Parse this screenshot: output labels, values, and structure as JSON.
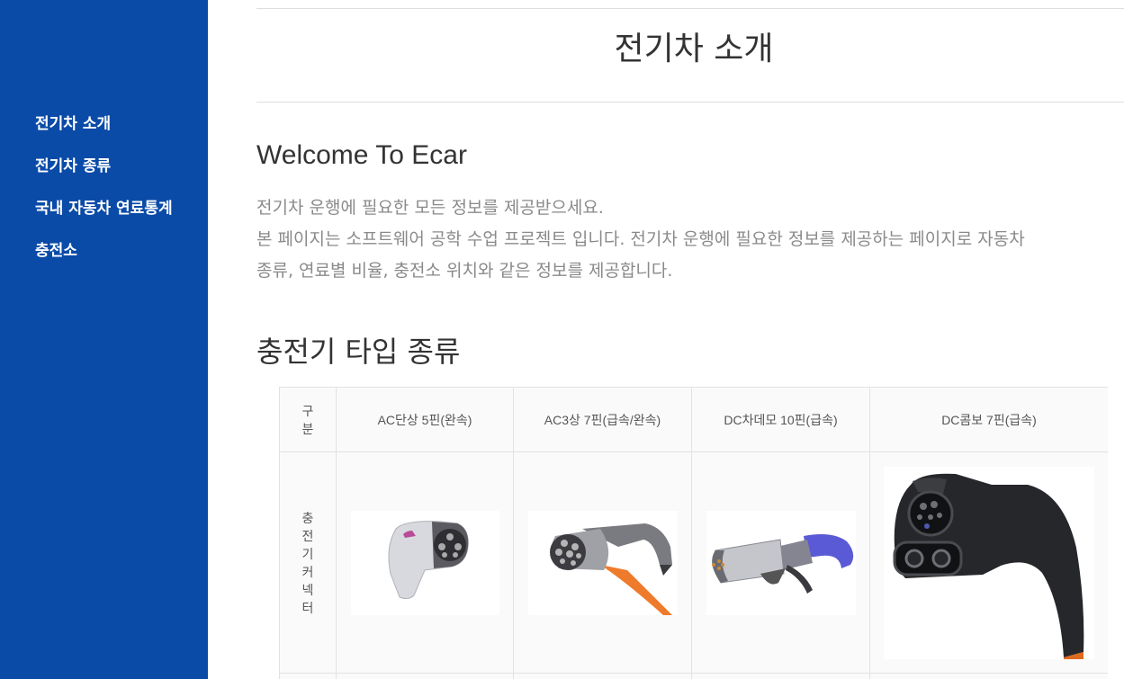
{
  "sidebar": {
    "items": [
      {
        "label": "전기차 소개"
      },
      {
        "label": "전기차 종류"
      },
      {
        "label": "국내 자동차 연료통계"
      },
      {
        "label": "충전소"
      }
    ]
  },
  "header": {
    "title": "전기차 소개"
  },
  "welcome": {
    "title": "Welcome To Ecar",
    "lines": [
      "전기차 운행에 필요한 모든 정보를 제공받으세요.",
      "본 페이지는 소프트웨어 공학 수업 프로젝트 입니다. 전기차 운행에 필요한 정보를 제공하는 페이지로 자동차",
      "종류, 연료별 비율, 충전소 위치와 같은 정보를 제공합니다."
    ]
  },
  "charger_section": {
    "title": "충전기 타입 종류",
    "table": {
      "corner_header": "구분",
      "columns": [
        "AC단상 5핀(완속)",
        "AC3상 7핀(급속/완속)",
        "DC차데모 10핀(급속)",
        "DC콤보 7핀(급속)"
      ],
      "row_label": "충전기커넥터",
      "images": [
        "ac-single-5pin-connector",
        "ac-3phase-7pin-connector",
        "dc-chademo-10pin-connector",
        "dc-combo-7pin-connector"
      ]
    }
  }
}
